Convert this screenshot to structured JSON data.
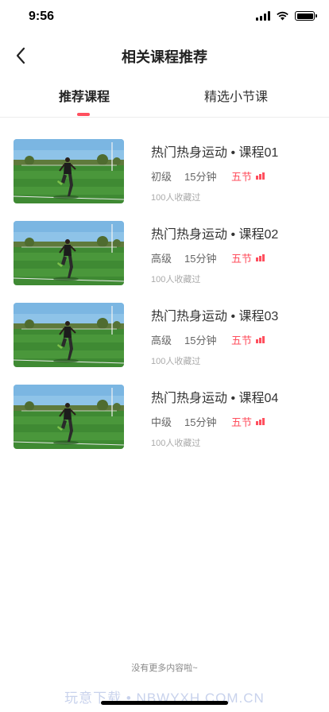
{
  "status": {
    "time": "9:56"
  },
  "header": {
    "title": "相关课程推荐"
  },
  "tabs": [
    {
      "label": "推荐课程",
      "active": true
    },
    {
      "label": "精选小节课",
      "active": false
    }
  ],
  "courses": [
    {
      "title": "热门热身运动 • 课程01",
      "level": "初级",
      "duration": "15分钟",
      "sections": "五节",
      "favorites": "100人收藏过"
    },
    {
      "title": "热门热身运动 • 课程02",
      "level": "高级",
      "duration": "15分钟",
      "sections": "五节",
      "favorites": "100人收藏过"
    },
    {
      "title": "热门热身运动 • 课程03",
      "level": "高级",
      "duration": "15分钟",
      "sections": "五节",
      "favorites": "100人收藏过"
    },
    {
      "title": "热门热身运动 • 课程04",
      "level": "中级",
      "duration": "15分钟",
      "sections": "五节",
      "favorites": "100人收藏过"
    }
  ],
  "footer": {
    "note": "没有更多内容啦~"
  },
  "watermark": "玩意下载 • NBWYXH.COM.CN",
  "colors": {
    "accent": "#ff4f5e"
  }
}
